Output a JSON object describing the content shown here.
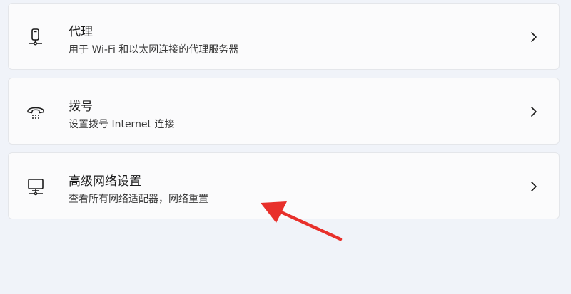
{
  "settings": {
    "items": [
      {
        "title": "代理",
        "subtitle": "用于 Wi-Fi 和以太网连接的代理服务器",
        "icon": "proxy-icon"
      },
      {
        "title": "拨号",
        "subtitle": "设置拨号 Internet 连接",
        "icon": "dialup-phone-icon"
      },
      {
        "title": "高级网络设置",
        "subtitle": "查看所有网络适配器，网络重置",
        "icon": "computer-network-icon"
      }
    ]
  },
  "colors": {
    "background": "#f0f3f9",
    "card": "#fbfbfc",
    "annotation_arrow": "#e8302b"
  }
}
